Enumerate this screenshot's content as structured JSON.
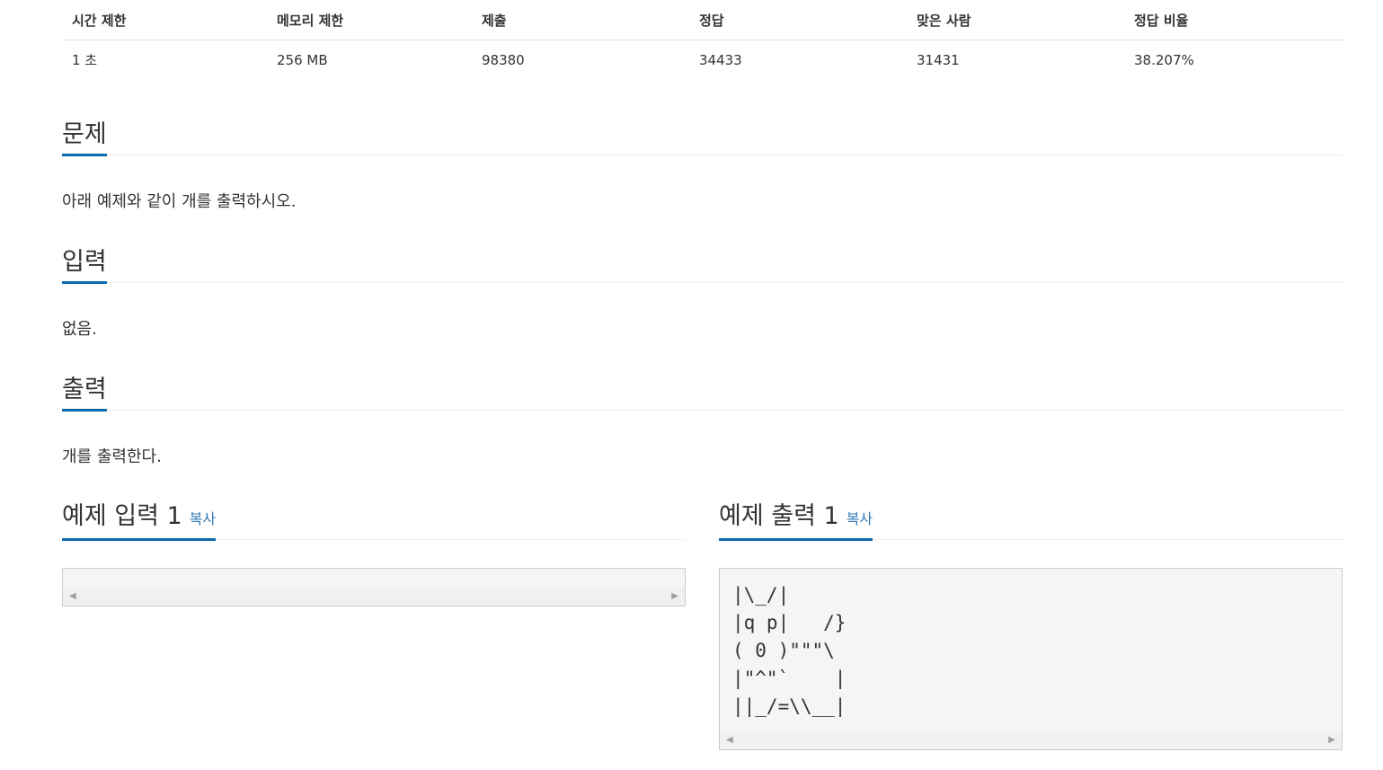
{
  "stats": {
    "headers": [
      "시간 제한",
      "메모리 제한",
      "제출",
      "정답",
      "맞은 사람",
      "정답 비율"
    ],
    "values": [
      "1 초",
      "256 MB",
      "98380",
      "34433",
      "31431",
      "38.207%"
    ]
  },
  "problem": {
    "title": "문제",
    "text": "아래 예제와 같이 개를 출력하시오."
  },
  "input": {
    "title": "입력",
    "text": "없음."
  },
  "output": {
    "title": "출력",
    "text": "개를 출력한다."
  },
  "sample_input": {
    "title": "예제 입력 1",
    "copy_label": "복사",
    "content": ""
  },
  "sample_output": {
    "title": "예제 출력 1",
    "copy_label": "복사",
    "content": "|\\_/|\n|q p|   /}\n( 0 )\"\"\"\\\n|\"^\"`    |\n||_/=\\\\__|"
  },
  "icons": {
    "scroll_left": "scroll-left-arrow-icon",
    "scroll_right": "scroll-right-arrow-icon"
  },
  "colors": {
    "accent_underline": "#0e6ab0",
    "copy_link": "#337ab7",
    "sample_bg": "#f5f5f5"
  }
}
